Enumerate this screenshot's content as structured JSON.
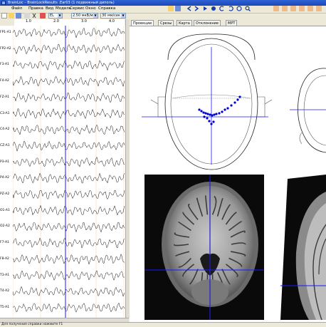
{
  "window": {
    "title": "BrainLoc – BrainLockResults .Ear03 (1 подвижный диполь)"
  },
  "menu": [
    "Файл",
    "Правка",
    "Вид",
    "Модель",
    "Сервис",
    "Окно",
    "Справка"
  ],
  "toolbar": {
    "montage": "EL",
    "sensitivity": "2.50 мкВ/мм",
    "timebase": "30 мм/сек"
  },
  "ruler": {
    "ticks": [
      "1.0",
      "2.0",
      "3.0",
      "4.0"
    ]
  },
  "channels": [
    "FP1-A1",
    "FP2-A2",
    "F3-A1",
    "F4-A2",
    "FZ-A1",
    "C3-A1",
    "C4-A2",
    "CZ-A1",
    "P3-A1",
    "P4-A2",
    "PZ-A2",
    "O1-A1",
    "O2-A2",
    "F7-A1",
    "F8-A2",
    "T3-A1",
    "T4-A2",
    "T5-A1"
  ],
  "tabs": [
    "Проекции",
    "Срезы",
    "Карта",
    "Отклонение",
    "МРТ"
  ],
  "status": {
    "text": "Для получения справки нажмите F1"
  },
  "colors": {
    "cursor": "#1a1aff",
    "dipole": "#0000cc",
    "titlebar": "#1c47b8"
  }
}
